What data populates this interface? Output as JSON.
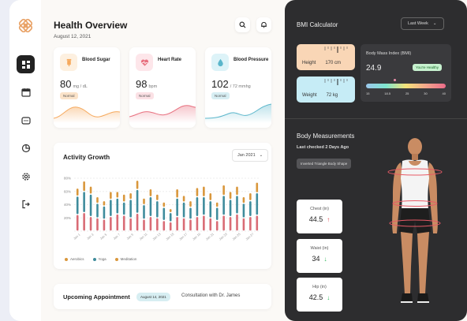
{
  "header": {
    "title": "Health Overview",
    "date": "August 12, 2021"
  },
  "vitals": [
    {
      "name": "Blood Sugar",
      "value": "80",
      "unit": "mg / dL",
      "status": "Normal",
      "accent": "#f6a95d",
      "icon_bg": "#fdf0e0",
      "badge_bg": "#fbe3c9"
    },
    {
      "name": "Heart Rate",
      "value": "98",
      "unit": "bpm",
      "status": "Normal",
      "accent": "#e8707f",
      "icon_bg": "#fde6ea",
      "badge_bg": "#fbe1e5"
    },
    {
      "name": "Blood Pressure",
      "value": "102",
      "unit": "/ 72 mmhg",
      "status": "Normal",
      "accent": "#5ab6cb",
      "icon_bg": "#ddf3f8",
      "badge_bg": "#d7eef3"
    }
  ],
  "activity": {
    "title": "Activity Growth",
    "month": "Jan 2021",
    "legend": [
      "Aerobics",
      "Yoga",
      "Meditation"
    ],
    "colors": [
      "#d96b75",
      "#3f8c9c",
      "#d9973c"
    ]
  },
  "chart_data": {
    "type": "bar",
    "categories": [
      "Jan 1",
      "Jan 2",
      "Jan 3",
      "Jan 4",
      "Jan 5",
      "Jan 6",
      "Jan 7",
      "Jan 8",
      "Jan 9",
      "Jan 10",
      "Jan 11",
      "Jan 12",
      "Jan 13",
      "Jan 14",
      "Jan 15",
      "Jan 16",
      "Jan 17",
      "Jan 18",
      "Jan 19",
      "Jan 20",
      "Jan 21",
      "Jan 22",
      "Jan 23",
      "Jan 24",
      "Jan 25",
      "Jan 26",
      "Jan 27",
      "Jan 28"
    ],
    "yticks": [
      "0%",
      "20%",
      "40%",
      "60%",
      "80%"
    ],
    "ylim": [
      0,
      80
    ],
    "series": [
      {
        "name": "Aerobics",
        "values": [
          25,
          28,
          22,
          20,
          18,
          22,
          26,
          24,
          20,
          27,
          18,
          22,
          20,
          16,
          14,
          22,
          20,
          18,
          22,
          24,
          20,
          16,
          24,
          22,
          26,
          20,
          22,
          24
        ]
      },
      {
        "name": "Yoga",
        "values": [
          28,
          32,
          34,
          22,
          20,
          26,
          24,
          20,
          28,
          36,
          22,
          30,
          26,
          20,
          14,
          28,
          24,
          18,
          30,
          28,
          26,
          20,
          30,
          26,
          28,
          22,
          24,
          34
        ]
      },
      {
        "name": "Meditation",
        "values": [
          12,
          16,
          12,
          10,
          8,
          12,
          10,
          12,
          10,
          14,
          10,
          12,
          10,
          8,
          6,
          14,
          10,
          10,
          14,
          16,
          12,
          8,
          16,
          12,
          14,
          10,
          12,
          16
        ]
      }
    ]
  },
  "appointment": {
    "title": "Upcoming Appointment",
    "date": "August 14, 2021",
    "text": "Consultation with Dr. James"
  },
  "bmi": {
    "title": "BMI Calculator",
    "period": "Last Week",
    "height_label": "Height",
    "height_value": "170 cm",
    "weight_label": "Weight",
    "weight_value": "72 kg",
    "index_label": "Body Mass Index (BMI)",
    "index_value": "24.9",
    "index_status": "You're Healthy",
    "index_fraction": 0.36,
    "scale": [
      "15",
      "18.5",
      "25",
      "30",
      "40"
    ]
  },
  "body": {
    "title": "Body Measurements",
    "subtitle": "Last checked 2 Days Ago",
    "shape": "Inverted Triangle Body Shape",
    "measurements": [
      {
        "label": "Chest (in)",
        "value": "44.5",
        "trend": "up"
      },
      {
        "label": "Waist (in)",
        "value": "34",
        "trend": "down"
      },
      {
        "label": "Hip (in)",
        "value": "42.5",
        "trend": "down"
      }
    ]
  }
}
